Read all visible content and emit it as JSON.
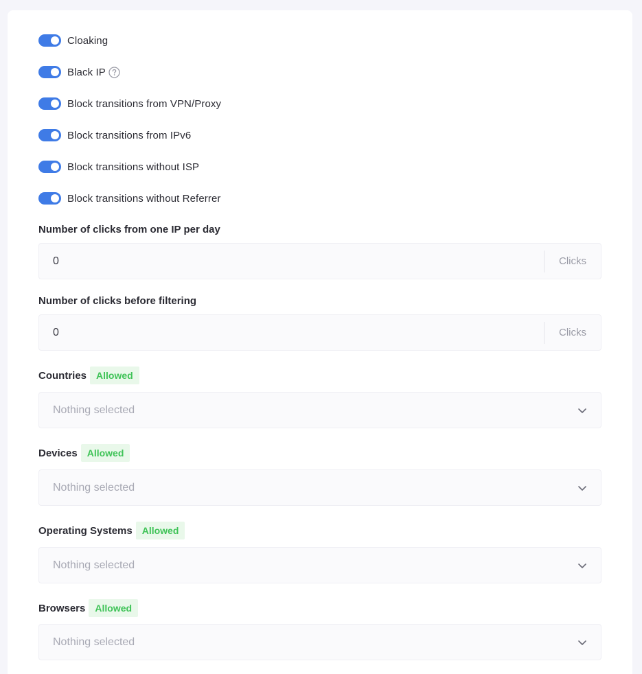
{
  "toggles": [
    {
      "label": "Cloaking",
      "on": true
    },
    {
      "label": "Black IP",
      "on": true
    },
    {
      "label": "Block transitions from VPN/Proxy",
      "on": true
    },
    {
      "label": "Block transitions from IPv6",
      "on": true
    },
    {
      "label": "Block transitions without ISP",
      "on": true
    },
    {
      "label": "Block transitions without Referrer",
      "on": true
    }
  ],
  "clicks_per_ip": {
    "label": "Number of clicks from one IP per day",
    "value": "0",
    "unit": "Clicks"
  },
  "clicks_before_filtering": {
    "label": "Number of clicks before filtering",
    "value": "0",
    "unit": "Clicks"
  },
  "filters": [
    {
      "label": "Countries",
      "badge": "Allowed",
      "placeholder": "Nothing selected"
    },
    {
      "label": "Devices",
      "badge": "Allowed",
      "placeholder": "Nothing selected"
    },
    {
      "label": "Operating Systems",
      "badge": "Allowed",
      "placeholder": "Nothing selected"
    },
    {
      "label": "Browsers",
      "badge": "Allowed",
      "placeholder": "Nothing selected"
    }
  ],
  "colors": {
    "accent": "#3f7be6",
    "badge_bg": "#e9f8ea",
    "badge_text": "#3fc357"
  },
  "icons": {
    "help": "question-circle-icon",
    "dropdown": "chevron-down-icon"
  }
}
